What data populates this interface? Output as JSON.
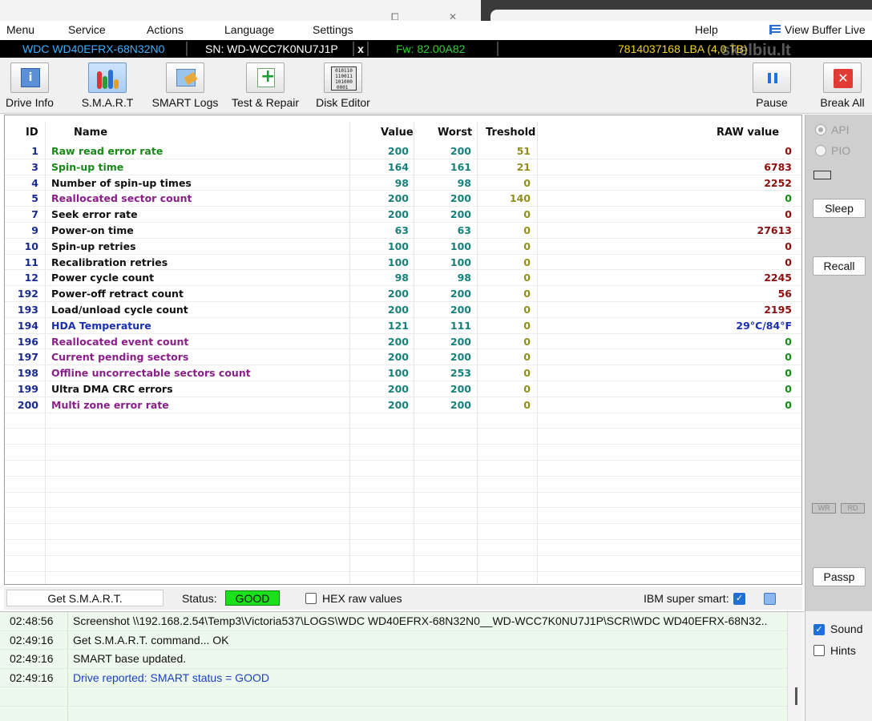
{
  "window": {
    "minimize_glyph": "⧠",
    "close_glyph": "✕"
  },
  "menu": {
    "items": [
      "Menu",
      "Service",
      "Actions",
      "Language",
      "Settings"
    ],
    "help": "Help",
    "view_buffer": "View Buffer Live"
  },
  "drive": {
    "model": "WDC WD40EFRX-68N32N0",
    "serial": "SN: WD-WCC7K0NU7J1P",
    "close": "x",
    "firmware": "Fw: 82.00A82",
    "lba": "7814037168 LBA (4,0 TB)"
  },
  "watermark": "skelbiu.lt",
  "toolbar": {
    "drive_info": "Drive Info",
    "smart": "S.M.A.R.T",
    "smart_logs": "SMART Logs",
    "test_repair": "Test & Repair",
    "disk_editor": "Disk Editor",
    "pause": "Pause",
    "break_all": "Break All",
    "disk_editor_icon_text": "010110\n110011\n101000\n0001 "
  },
  "table": {
    "headers": {
      "id": "ID",
      "name": "Name",
      "value": "Value",
      "worst": "Worst",
      "threshold": "Treshold",
      "raw": "RAW value"
    },
    "rows": [
      {
        "id": "1",
        "name": "Raw read error rate",
        "value": "200",
        "worst": "200",
        "threshold": "51",
        "raw": "0",
        "name_color": "#178a17",
        "raw_color": "#8a1010"
      },
      {
        "id": "3",
        "name": "Spin-up time",
        "value": "164",
        "worst": "161",
        "threshold": "21",
        "raw": "6783",
        "name_color": "#178a17",
        "raw_color": "#8a1010"
      },
      {
        "id": "4",
        "name": "Number of spin-up times",
        "value": "98",
        "worst": "98",
        "threshold": "0",
        "raw": "2252",
        "name_color": "#111111",
        "raw_color": "#8a1010"
      },
      {
        "id": "5",
        "name": "Reallocated sector count",
        "value": "200",
        "worst": "200",
        "threshold": "140",
        "raw": "0",
        "name_color": "#8a1f8a",
        "raw_color": "#178a17"
      },
      {
        "id": "7",
        "name": "Seek error rate",
        "value": "200",
        "worst": "200",
        "threshold": "0",
        "raw": "0",
        "name_color": "#111111",
        "raw_color": "#8a1010"
      },
      {
        "id": "9",
        "name": "Power-on time",
        "value": "63",
        "worst": "63",
        "threshold": "0",
        "raw": "27613",
        "name_color": "#111111",
        "raw_color": "#8a1010"
      },
      {
        "id": "10",
        "name": "Spin-up retries",
        "value": "100",
        "worst": "100",
        "threshold": "0",
        "raw": "0",
        "name_color": "#111111",
        "raw_color": "#8a1010"
      },
      {
        "id": "11",
        "name": "Recalibration retries",
        "value": "100",
        "worst": "100",
        "threshold": "0",
        "raw": "0",
        "name_color": "#111111",
        "raw_color": "#8a1010"
      },
      {
        "id": "12",
        "name": "Power cycle count",
        "value": "98",
        "worst": "98",
        "threshold": "0",
        "raw": "2245",
        "name_color": "#111111",
        "raw_color": "#8a1010"
      },
      {
        "id": "192",
        "name": "Power-off retract count",
        "value": "200",
        "worst": "200",
        "threshold": "0",
        "raw": "56",
        "name_color": "#111111",
        "raw_color": "#8a1010"
      },
      {
        "id": "193",
        "name": "Load/unload cycle count",
        "value": "200",
        "worst": "200",
        "threshold": "0",
        "raw": "2195",
        "name_color": "#111111",
        "raw_color": "#8a1010"
      },
      {
        "id": "194",
        "name": "HDA Temperature",
        "value": "121",
        "worst": "111",
        "threshold": "0",
        "raw": "29°C/84°F",
        "name_color": "#1a2fb0",
        "raw_color": "#1a2fb0"
      },
      {
        "id": "196",
        "name": "Reallocated event count",
        "value": "200",
        "worst": "200",
        "threshold": "0",
        "raw": "0",
        "name_color": "#8a1f8a",
        "raw_color": "#178a17"
      },
      {
        "id": "197",
        "name": "Current pending sectors",
        "value": "200",
        "worst": "200",
        "threshold": "0",
        "raw": "0",
        "name_color": "#8a1f8a",
        "raw_color": "#178a17"
      },
      {
        "id": "198",
        "name": "Offline uncorrectable sectors count",
        "value": "100",
        "worst": "253",
        "threshold": "0",
        "raw": "0",
        "name_color": "#8a1f8a",
        "raw_color": "#178a17"
      },
      {
        "id": "199",
        "name": "Ultra DMA CRC errors",
        "value": "200",
        "worst": "200",
        "threshold": "0",
        "raw": "0",
        "name_color": "#111111",
        "raw_color": "#178a17"
      },
      {
        "id": "200",
        "name": "Multi zone error rate",
        "value": "200",
        "worst": "200",
        "threshold": "0",
        "raw": "0",
        "name_color": "#8a1f8a",
        "raw_color": "#178a17"
      }
    ]
  },
  "status": {
    "get_smart": "Get S.M.A.R.T.",
    "status_label": "Status:",
    "status_value": "GOOD",
    "status_color": "#1be01b",
    "hex_label": "HEX raw values",
    "ibm_label": "IBM super smart:",
    "checkmark": "✓"
  },
  "side": {
    "api": "API",
    "pio": "PIO",
    "sleep": "Sleep",
    "recall": "Recall",
    "wr": "WR",
    "rd": "RD",
    "passp": "Passp"
  },
  "log": {
    "lines": [
      {
        "time": "02:48:56",
        "msg": "Screenshot \\\\192.168.2.54\\Temp3\\Victoria537\\LOGS\\WDC WD40EFRX-68N32N0__WD-WCC7K0NU7J1P\\SCR\\WDC WD40EFRX-68N32..",
        "color": "#111111"
      },
      {
        "time": "02:49:16",
        "msg": "Get S.M.A.R.T. command... OK",
        "color": "#111111"
      },
      {
        "time": "02:49:16",
        "msg": "SMART base updated.",
        "color": "#111111"
      },
      {
        "time": "02:49:16",
        "msg": "Drive reported: SMART status = GOOD",
        "color": "#1a3fc0"
      }
    ],
    "sound": "Sound",
    "hints": "Hints"
  }
}
